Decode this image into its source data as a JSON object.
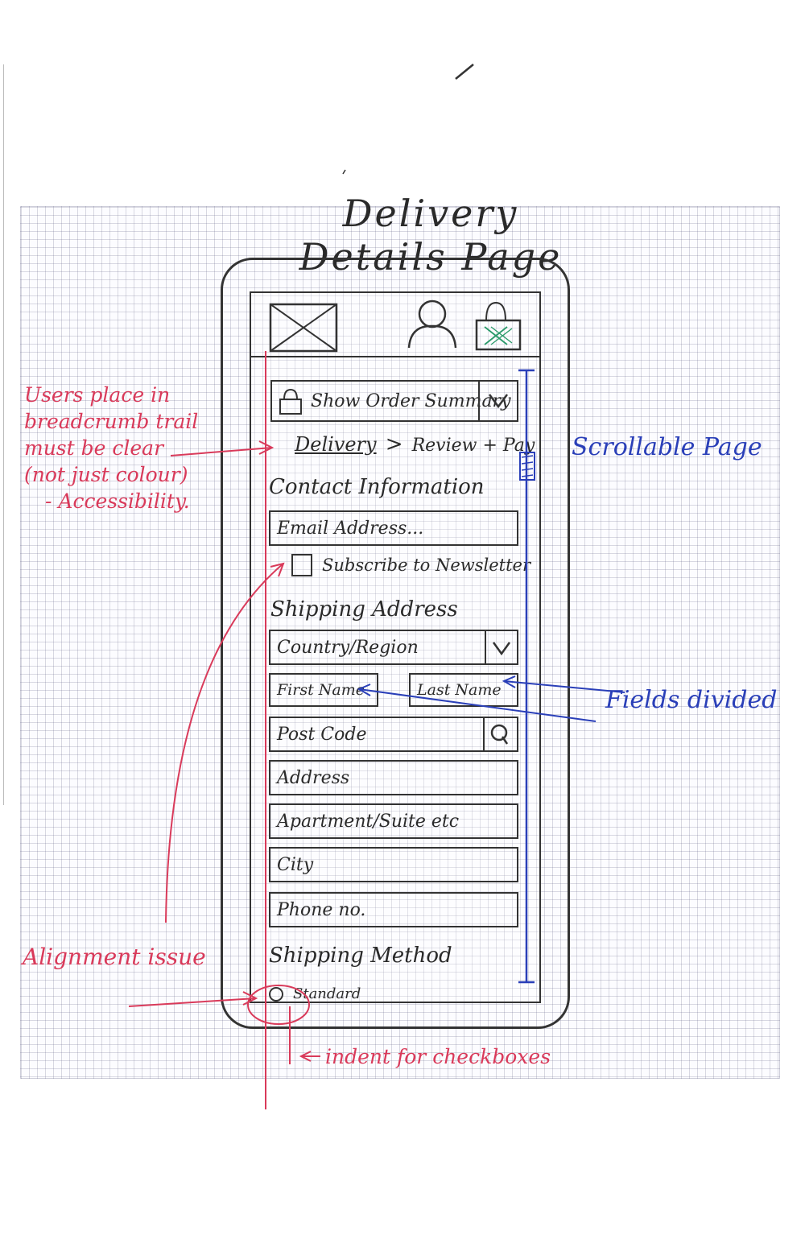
{
  "page_title": "Delivery Details Page",
  "header": {
    "logo_icon": "image-placeholder-icon",
    "account_icon": "user-icon",
    "cart_icon": "shopping-bag-icon"
  },
  "order_summary": {
    "label": "Show Order Summary",
    "icon": "lock-icon",
    "dropdown_icon": "chevron-down-icon"
  },
  "breadcrumb": {
    "current": "Delivery",
    "separator": ">",
    "next": "Review + Pay"
  },
  "contact": {
    "heading": "Contact Information",
    "email_placeholder": "Email Address...",
    "newsletter_label": "Subscribe to Newsletter"
  },
  "shipping_address": {
    "heading": "Shipping Address",
    "country_placeholder": "Country/Region",
    "first_name_placeholder": "First Name",
    "last_name_placeholder": "Last Name",
    "post_code_placeholder": "Post Code",
    "address_placeholder": "Address",
    "apartment_placeholder": "Apartment/Suite etc",
    "city_placeholder": "City",
    "phone_placeholder": "Phone no."
  },
  "shipping_method": {
    "heading": "Shipping Method",
    "option_standard": "Standard"
  },
  "annotations": {
    "breadcrumb_note": [
      "Users place in",
      "breadcrumb trail",
      "must be clear",
      "(not just colour)",
      "- Accessibility."
    ],
    "scrollable": "Scrollable Page",
    "fields_divided": "Fields divided",
    "alignment": "Alignment issue",
    "indent": "indent for checkboxes"
  },
  "colors": {
    "pencil": "#2a2a2a",
    "annotation_red": "#d93a5a",
    "annotation_blue": "#2a3fb8",
    "cart_mark": "#2a9a6a"
  }
}
